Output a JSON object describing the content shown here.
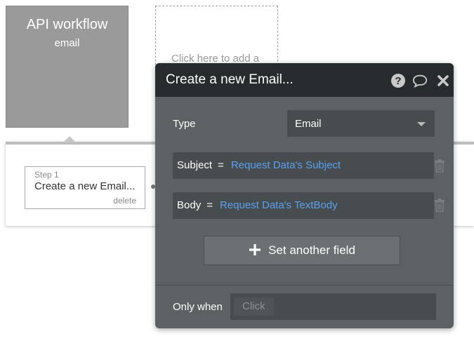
{
  "event": {
    "title": "API workflow",
    "subtitle": "email"
  },
  "add_action": {
    "label": "Click here to add a"
  },
  "step": {
    "label": "Step 1",
    "name": "Create a new Email...",
    "delete_label": "delete"
  },
  "panel": {
    "title": "Create a new Email...",
    "type_label": "Type",
    "type_value": "Email",
    "fields": [
      {
        "key": "Subject",
        "eq": "=",
        "value": "Request Data's Subject"
      },
      {
        "key": "Body",
        "eq": "=",
        "value": "Request Data's TextBody"
      }
    ],
    "add_field_label": "Set another field",
    "only_when_label": "Only when",
    "only_when_placeholder": "Click"
  },
  "icons": {
    "help": "help-icon",
    "comment": "comment-icon",
    "close": "close-icon",
    "trash": "trash-icon",
    "plus": "plus-icon",
    "caret": "caret-down-icon"
  },
  "colors": {
    "panel_bg": "#5c6164",
    "header_bg": "#262b2d",
    "dynamic_value": "#5aa0f0",
    "event_card": "#9a9a9a"
  }
}
